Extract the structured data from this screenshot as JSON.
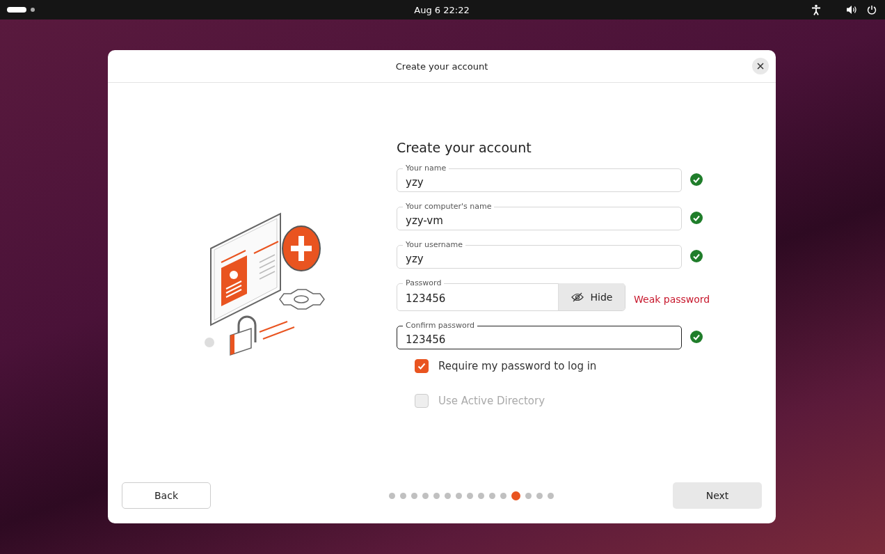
{
  "top_bar": {
    "clock": "Aug 6  22:22"
  },
  "window": {
    "title": "Create your account"
  },
  "form": {
    "heading": "Create your account",
    "fields": [
      {
        "kind": "text",
        "label": "Your name",
        "value": "yzy",
        "focused": false,
        "valid": true
      },
      {
        "kind": "text",
        "label": "Your computer's name",
        "value": "yzy-vm",
        "focused": false,
        "valid": true
      },
      {
        "kind": "text",
        "label": "Your username",
        "value": "yzy",
        "focused": false,
        "valid": true
      },
      {
        "kind": "password",
        "label": "Password",
        "value": "123456",
        "focused": false,
        "valid": false,
        "reveal_button": "Hide",
        "strength": "Weak password"
      },
      {
        "kind": "text",
        "label": "Confirm password",
        "value": "123456",
        "focused": true,
        "valid": true
      }
    ],
    "options": [
      {
        "label": "Require my password to log in",
        "checked": true,
        "disabled": false
      },
      {
        "label": "Use Active Directory",
        "checked": false,
        "disabled": true
      }
    ]
  },
  "footer": {
    "back": "Back",
    "next": "Next",
    "steps": [
      {
        "selected": false
      },
      {
        "selected": false
      },
      {
        "selected": false
      },
      {
        "selected": false
      },
      {
        "selected": false
      },
      {
        "selected": false
      },
      {
        "selected": false
      },
      {
        "selected": false
      },
      {
        "selected": false
      },
      {
        "selected": false
      },
      {
        "selected": false
      },
      {
        "selected": true
      },
      {
        "selected": false
      },
      {
        "selected": false
      },
      {
        "selected": false
      }
    ]
  }
}
